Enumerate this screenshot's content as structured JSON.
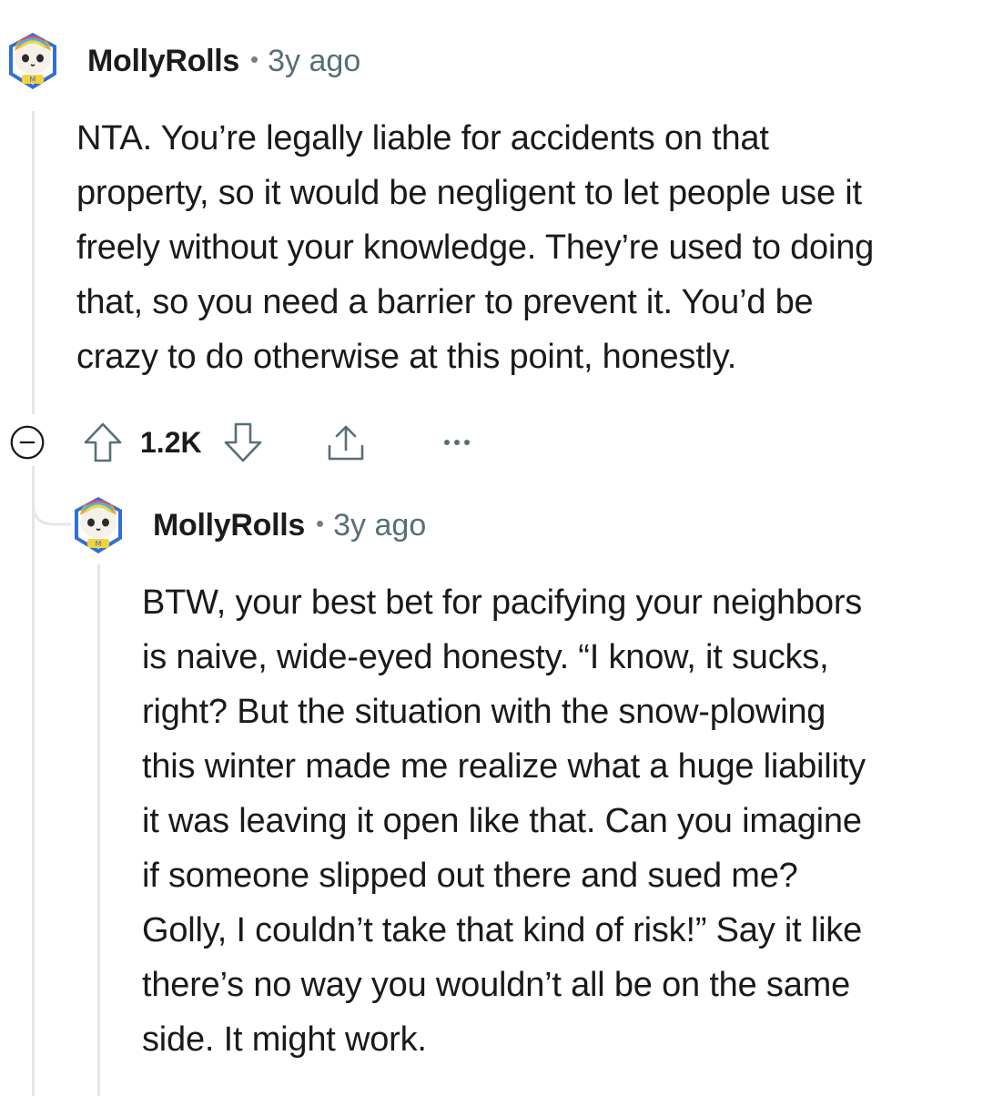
{
  "comments": [
    {
      "username": "MollyRolls",
      "separator": "•",
      "age": "3y ago",
      "avatar_icon": "cat-avatar-icon",
      "lines": [
        "NTA. You’re legally liable for accidents on that",
        "property, so it would be negligent to let people use it",
        "freely without your knowledge. They’re used to doing",
        "that, so you need a barrier to prevent it. You’d be",
        "crazy to do otherwise at this point, honestly."
      ],
      "actions": {
        "collapse_icon": "collapse-minus-icon",
        "upvote_icon": "upvote-arrow-icon",
        "score": "1.2K",
        "downvote_icon": "downvote-arrow-icon",
        "share_icon": "share-icon",
        "more_icon": "more-dots-icon"
      }
    },
    {
      "username": "MollyRolls",
      "separator": "•",
      "age": "3y ago",
      "avatar_icon": "cat-avatar-icon",
      "lines": [
        "BTW, your best bet for pacifying your neighbors",
        "is naive, wide-eyed honesty. “I know, it sucks,",
        "right? But the situation with the snow-plowing",
        "this winter made me realize what a huge liability",
        "it was leaving it open like that. Can you imagine",
        "if someone slipped out there and sued me?",
        "Golly, I couldn’t take that kind of risk!” Say it like",
        "there’s no way you wouldn’t all be on the same",
        "side. It might work."
      ]
    }
  ],
  "colors": {
    "thread_line": "#e4e6e8",
    "age_text": "#576f76",
    "icon_stroke": "#576f76"
  }
}
